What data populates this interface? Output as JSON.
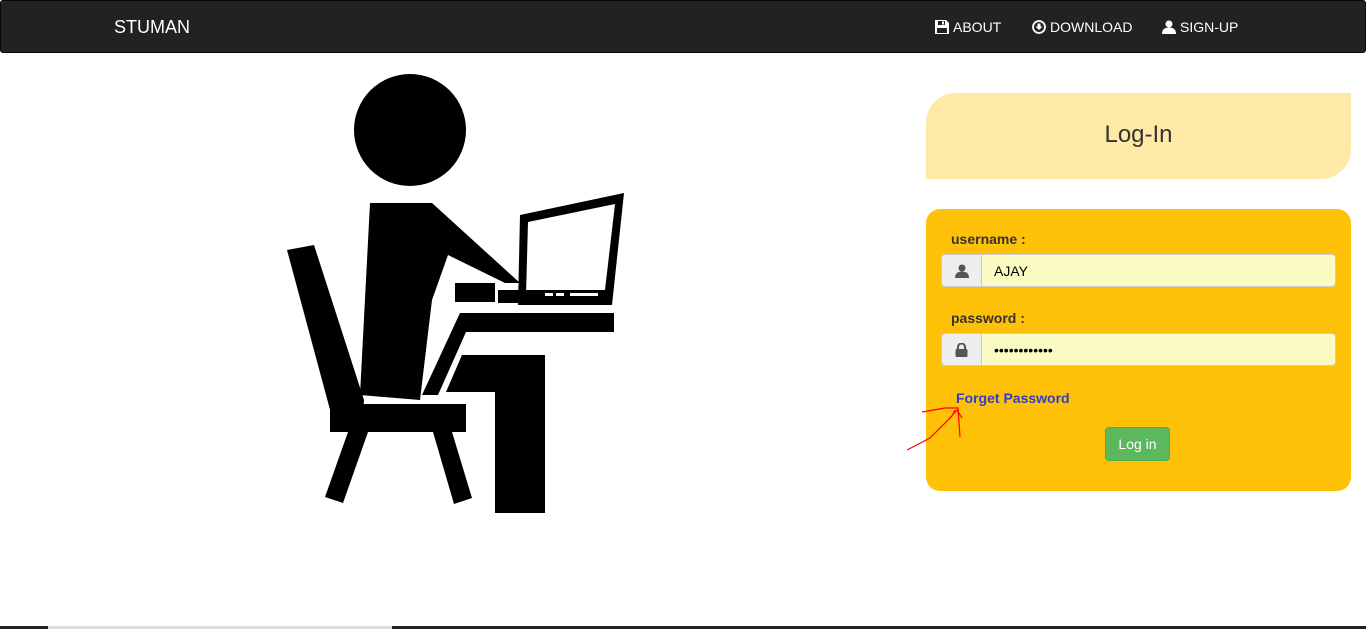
{
  "navbar": {
    "brand": "STUMAN",
    "items": [
      {
        "label": "ABOUT",
        "icon": "floppy-disk-icon"
      },
      {
        "label": "DOWNLOAD",
        "icon": "download-circle-icon"
      },
      {
        "label": "SIGN-UP",
        "icon": "user-icon"
      }
    ]
  },
  "illustration": {
    "icon": "person-at-laptop-icon"
  },
  "login": {
    "heading": "Log-In",
    "username_label": "username :",
    "username_value": "AJAY",
    "password_label": "password :",
    "password_value": "••••••••••••",
    "forget_link": "Forget Password",
    "submit_label": "Log in"
  },
  "colors": {
    "navbar": "#222222",
    "header_panel": "#ffe9a6",
    "login_panel": "#ffc107",
    "input_bg": "#fafcc4",
    "link": "#2f3ec8",
    "button": "#5cb85c",
    "annotation": "#ff0000"
  }
}
